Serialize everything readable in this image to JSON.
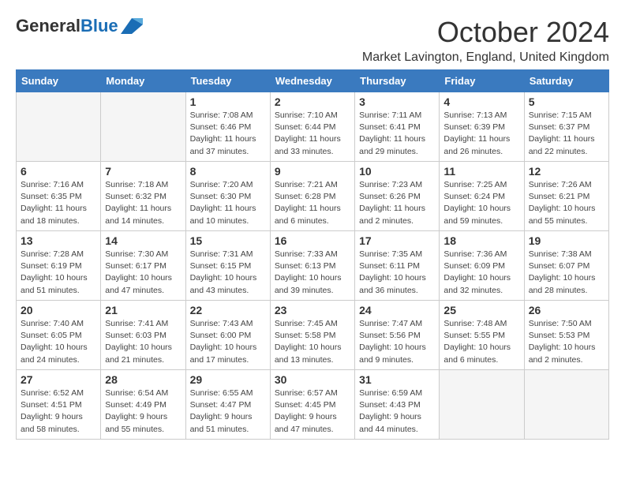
{
  "header": {
    "logo_general": "General",
    "logo_blue": "Blue",
    "month_title": "October 2024",
    "location": "Market Lavington, England, United Kingdom"
  },
  "days_of_week": [
    "Sunday",
    "Monday",
    "Tuesday",
    "Wednesday",
    "Thursday",
    "Friday",
    "Saturday"
  ],
  "weeks": [
    [
      {
        "day": "",
        "empty": true
      },
      {
        "day": "",
        "empty": true
      },
      {
        "day": "1",
        "sunrise": "Sunrise: 7:08 AM",
        "sunset": "Sunset: 6:46 PM",
        "daylight": "Daylight: 11 hours and 37 minutes."
      },
      {
        "day": "2",
        "sunrise": "Sunrise: 7:10 AM",
        "sunset": "Sunset: 6:44 PM",
        "daylight": "Daylight: 11 hours and 33 minutes."
      },
      {
        "day": "3",
        "sunrise": "Sunrise: 7:11 AM",
        "sunset": "Sunset: 6:41 PM",
        "daylight": "Daylight: 11 hours and 29 minutes."
      },
      {
        "day": "4",
        "sunrise": "Sunrise: 7:13 AM",
        "sunset": "Sunset: 6:39 PM",
        "daylight": "Daylight: 11 hours and 26 minutes."
      },
      {
        "day": "5",
        "sunrise": "Sunrise: 7:15 AM",
        "sunset": "Sunset: 6:37 PM",
        "daylight": "Daylight: 11 hours and 22 minutes."
      }
    ],
    [
      {
        "day": "6",
        "sunrise": "Sunrise: 7:16 AM",
        "sunset": "Sunset: 6:35 PM",
        "daylight": "Daylight: 11 hours and 18 minutes."
      },
      {
        "day": "7",
        "sunrise": "Sunrise: 7:18 AM",
        "sunset": "Sunset: 6:32 PM",
        "daylight": "Daylight: 11 hours and 14 minutes."
      },
      {
        "day": "8",
        "sunrise": "Sunrise: 7:20 AM",
        "sunset": "Sunset: 6:30 PM",
        "daylight": "Daylight: 11 hours and 10 minutes."
      },
      {
        "day": "9",
        "sunrise": "Sunrise: 7:21 AM",
        "sunset": "Sunset: 6:28 PM",
        "daylight": "Daylight: 11 hours and 6 minutes."
      },
      {
        "day": "10",
        "sunrise": "Sunrise: 7:23 AM",
        "sunset": "Sunset: 6:26 PM",
        "daylight": "Daylight: 11 hours and 2 minutes."
      },
      {
        "day": "11",
        "sunrise": "Sunrise: 7:25 AM",
        "sunset": "Sunset: 6:24 PM",
        "daylight": "Daylight: 10 hours and 59 minutes."
      },
      {
        "day": "12",
        "sunrise": "Sunrise: 7:26 AM",
        "sunset": "Sunset: 6:21 PM",
        "daylight": "Daylight: 10 hours and 55 minutes."
      }
    ],
    [
      {
        "day": "13",
        "sunrise": "Sunrise: 7:28 AM",
        "sunset": "Sunset: 6:19 PM",
        "daylight": "Daylight: 10 hours and 51 minutes."
      },
      {
        "day": "14",
        "sunrise": "Sunrise: 7:30 AM",
        "sunset": "Sunset: 6:17 PM",
        "daylight": "Daylight: 10 hours and 47 minutes."
      },
      {
        "day": "15",
        "sunrise": "Sunrise: 7:31 AM",
        "sunset": "Sunset: 6:15 PM",
        "daylight": "Daylight: 10 hours and 43 minutes."
      },
      {
        "day": "16",
        "sunrise": "Sunrise: 7:33 AM",
        "sunset": "Sunset: 6:13 PM",
        "daylight": "Daylight: 10 hours and 39 minutes."
      },
      {
        "day": "17",
        "sunrise": "Sunrise: 7:35 AM",
        "sunset": "Sunset: 6:11 PM",
        "daylight": "Daylight: 10 hours and 36 minutes."
      },
      {
        "day": "18",
        "sunrise": "Sunrise: 7:36 AM",
        "sunset": "Sunset: 6:09 PM",
        "daylight": "Daylight: 10 hours and 32 minutes."
      },
      {
        "day": "19",
        "sunrise": "Sunrise: 7:38 AM",
        "sunset": "Sunset: 6:07 PM",
        "daylight": "Daylight: 10 hours and 28 minutes."
      }
    ],
    [
      {
        "day": "20",
        "sunrise": "Sunrise: 7:40 AM",
        "sunset": "Sunset: 6:05 PM",
        "daylight": "Daylight: 10 hours and 24 minutes."
      },
      {
        "day": "21",
        "sunrise": "Sunrise: 7:41 AM",
        "sunset": "Sunset: 6:03 PM",
        "daylight": "Daylight: 10 hours and 21 minutes."
      },
      {
        "day": "22",
        "sunrise": "Sunrise: 7:43 AM",
        "sunset": "Sunset: 6:00 PM",
        "daylight": "Daylight: 10 hours and 17 minutes."
      },
      {
        "day": "23",
        "sunrise": "Sunrise: 7:45 AM",
        "sunset": "Sunset: 5:58 PM",
        "daylight": "Daylight: 10 hours and 13 minutes."
      },
      {
        "day": "24",
        "sunrise": "Sunrise: 7:47 AM",
        "sunset": "Sunset: 5:56 PM",
        "daylight": "Daylight: 10 hours and 9 minutes."
      },
      {
        "day": "25",
        "sunrise": "Sunrise: 7:48 AM",
        "sunset": "Sunset: 5:55 PM",
        "daylight": "Daylight: 10 hours and 6 minutes."
      },
      {
        "day": "26",
        "sunrise": "Sunrise: 7:50 AM",
        "sunset": "Sunset: 5:53 PM",
        "daylight": "Daylight: 10 hours and 2 minutes."
      }
    ],
    [
      {
        "day": "27",
        "sunrise": "Sunrise: 6:52 AM",
        "sunset": "Sunset: 4:51 PM",
        "daylight": "Daylight: 9 hours and 58 minutes."
      },
      {
        "day": "28",
        "sunrise": "Sunrise: 6:54 AM",
        "sunset": "Sunset: 4:49 PM",
        "daylight": "Daylight: 9 hours and 55 minutes."
      },
      {
        "day": "29",
        "sunrise": "Sunrise: 6:55 AM",
        "sunset": "Sunset: 4:47 PM",
        "daylight": "Daylight: 9 hours and 51 minutes."
      },
      {
        "day": "30",
        "sunrise": "Sunrise: 6:57 AM",
        "sunset": "Sunset: 4:45 PM",
        "daylight": "Daylight: 9 hours and 47 minutes."
      },
      {
        "day": "31",
        "sunrise": "Sunrise: 6:59 AM",
        "sunset": "Sunset: 4:43 PM",
        "daylight": "Daylight: 9 hours and 44 minutes."
      },
      {
        "day": "",
        "empty": true
      },
      {
        "day": "",
        "empty": true
      }
    ]
  ]
}
